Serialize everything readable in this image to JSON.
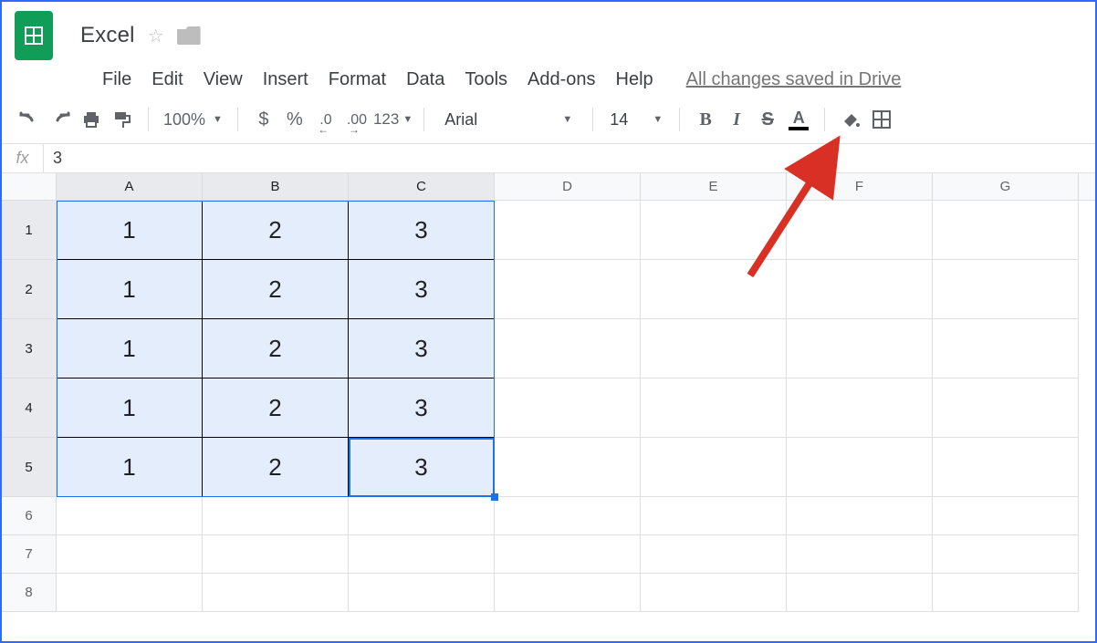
{
  "doc": {
    "title": "Excel"
  },
  "menu": {
    "items": [
      "File",
      "Edit",
      "View",
      "Insert",
      "Format",
      "Data",
      "Tools",
      "Add-ons",
      "Help"
    ],
    "save_status": "All changes saved in Drive"
  },
  "toolbar": {
    "zoom": "100%",
    "currency": "$",
    "percent": "%",
    "dec_dec": ".0",
    "inc_dec": ".00",
    "more_fmt": "123",
    "font": "Arial",
    "font_size": "14",
    "bold": "B",
    "italic": "I",
    "strike": "S",
    "text_color_letter": "A"
  },
  "formula": {
    "label": "fx",
    "value": "3"
  },
  "grid": {
    "columns": [
      "A",
      "B",
      "C",
      "D",
      "E",
      "F",
      "G"
    ],
    "selected_cols": [
      "A",
      "B",
      "C"
    ],
    "row_count": 8,
    "data_row_height": 65,
    "tail_row_height": 42,
    "data_col_width": 160,
    "rest_col_width": 160,
    "selected_rows": [
      1,
      2,
      3,
      4,
      5
    ],
    "data": [
      [
        "1",
        "2",
        "3"
      ],
      [
        "1",
        "2",
        "3"
      ],
      [
        "1",
        "2",
        "3"
      ],
      [
        "1",
        "2",
        "3"
      ],
      [
        "1",
        "2",
        "3"
      ]
    ],
    "active_cell": {
      "row": 5,
      "col": 3
    }
  },
  "annotation": {
    "arrow_color": "#d93025",
    "target": "bold-button"
  }
}
